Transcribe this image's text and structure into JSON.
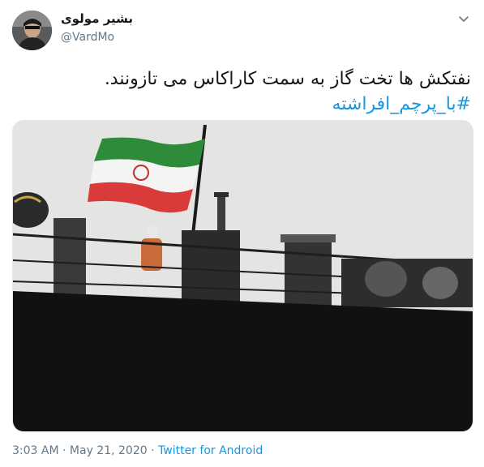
{
  "tweet": {
    "display_name": "بشیر مولوی",
    "handle": "@VardMo",
    "text": "نفتکش ها تخت گاز به سمت کاراکاس می تازونند.",
    "hashtag": "#با_پرچم_افراشته",
    "time": "3:03 AM",
    "separator": "·",
    "date": "May 21, 2020",
    "source": "Twitter for Android"
  },
  "icons": {
    "menu": "chevron-down-icon"
  },
  "colors": {
    "link": "#1b95e0",
    "muted": "#657786",
    "text": "#14171a"
  }
}
